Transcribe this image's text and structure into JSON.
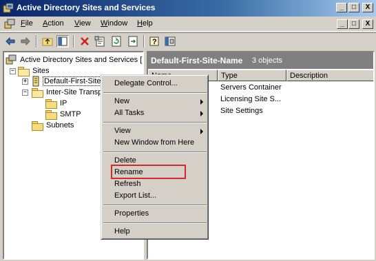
{
  "window": {
    "title": "Active Directory Sites and Services",
    "controls": [
      "_",
      "□",
      "X"
    ],
    "mdi_controls": [
      "_",
      "□",
      "X"
    ]
  },
  "menubar": {
    "items": [
      {
        "label": "File",
        "key": "F"
      },
      {
        "label": "Action",
        "key": "A"
      },
      {
        "label": "View",
        "key": "V"
      },
      {
        "label": "Window",
        "key": "W"
      },
      {
        "label": "Help",
        "key": "H"
      }
    ]
  },
  "toolbar": {
    "buttons": [
      "back-icon",
      "forward-icon",
      "up-folder-icon",
      "show-tree-icon",
      "delete-icon",
      "properties-icon",
      "refresh-icon",
      "export-list-icon",
      "help-icon",
      "mmc-icon"
    ]
  },
  "tree": {
    "root": "Active Directory Sites and Services [1",
    "sites": "Sites",
    "default_site": "Default-First-Site",
    "inter_site": "Inter-Site Transp",
    "ip": "IP",
    "smtp": "SMTP",
    "subnets": "Subnets",
    "expander_minus": "−",
    "expander_plus": "+"
  },
  "details": {
    "header_title": "Default-First-Site-Name",
    "object_count": "3 objects",
    "columns": [
      "Name",
      "Type",
      "Description"
    ],
    "rows": [
      {
        "type": "Servers Container"
      },
      {
        "type": "Licensing Site S..."
      },
      {
        "type": "Site Settings"
      }
    ]
  },
  "context_menu": {
    "delegate_control": "Delegate Control...",
    "new": "New",
    "all_tasks": "All Tasks",
    "view": "View",
    "new_window": "New Window from Here",
    "delete": "Delete",
    "rename": "Rename",
    "refresh": "Refresh",
    "export_list": "Export List...",
    "properties": "Properties",
    "help": "Help"
  },
  "colors": {
    "title_bar": "#0a246a",
    "highlight_box": "#d8252a",
    "pane_header": "#808080"
  }
}
